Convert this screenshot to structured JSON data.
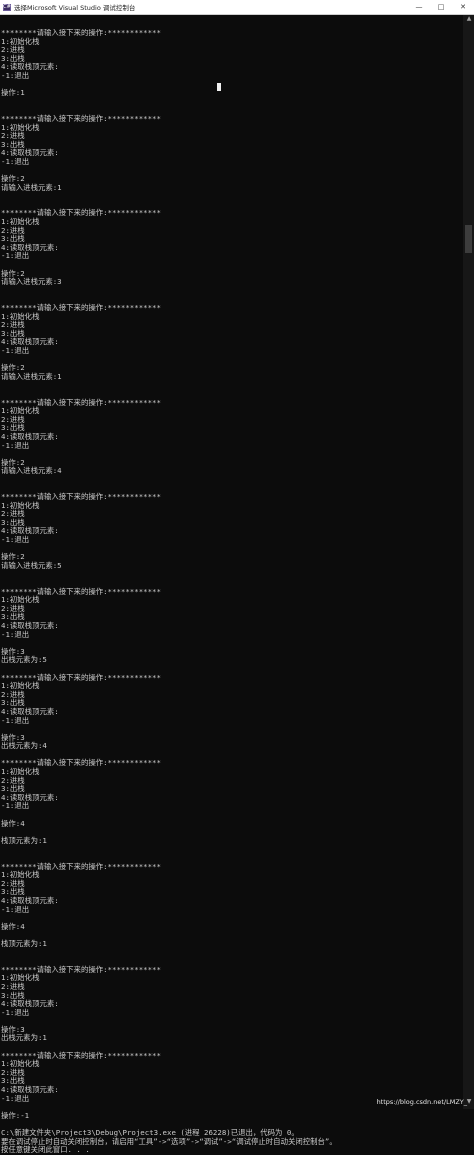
{
  "window": {
    "title": "选择Microsoft Visual Studio 调试控制台",
    "app_icon_glyph": "C#",
    "controls": [
      "—",
      "□",
      "✕"
    ]
  },
  "console_lines": [
    "********请输入接下来的操作:************",
    "1:初始化栈",
    "2:进栈",
    "3:出栈",
    "4:读取栈顶元素:",
    "-1:退出",
    "",
    "操作:1",
    "",
    "",
    "********请输入接下来的操作:************",
    "1:初始化栈",
    "2:进栈",
    "3:出栈",
    "4:读取栈顶元素:",
    "-1:退出",
    "",
    "操作:2",
    "请输入进栈元素:1",
    "",
    "",
    "********请输入接下来的操作:************",
    "1:初始化栈",
    "2:进栈",
    "3:出栈",
    "4:读取栈顶元素:",
    "-1:退出",
    "",
    "操作:2",
    "请输入进栈元素:3",
    "",
    "",
    "********请输入接下来的操作:************",
    "1:初始化栈",
    "2:进栈",
    "3:出栈",
    "4:读取栈顶元素:",
    "-1:退出",
    "",
    "操作:2",
    "请输入进栈元素:1",
    "",
    "",
    "********请输入接下来的操作:************",
    "1:初始化栈",
    "2:进栈",
    "3:出栈",
    "4:读取栈顶元素:",
    "-1:退出",
    "",
    "操作:2",
    "请输入进栈元素:4",
    "",
    "",
    "********请输入接下来的操作:************",
    "1:初始化栈",
    "2:进栈",
    "3:出栈",
    "4:读取栈顶元素:",
    "-1:退出",
    "",
    "操作:2",
    "请输入进栈元素:5",
    "",
    "",
    "********请输入接下来的操作:************",
    "1:初始化栈",
    "2:进栈",
    "3:出栈",
    "4:读取栈顶元素:",
    "-1:退出",
    "",
    "操作:3",
    "出栈元素为:5",
    "",
    "********请输入接下来的操作:************",
    "1:初始化栈",
    "2:进栈",
    "3:出栈",
    "4:读取栈顶元素:",
    "-1:退出",
    "",
    "操作:3",
    "出栈元素为:4",
    "",
    "********请输入接下来的操作:************",
    "1:初始化栈",
    "2:进栈",
    "3:出栈",
    "4:读取栈顶元素:",
    "-1:退出",
    "",
    "操作:4",
    "",
    "栈顶元素为:1",
    "",
    "",
    "********请输入接下来的操作:************",
    "1:初始化栈",
    "2:进栈",
    "3:出栈",
    "4:读取栈顶元素:",
    "-1:退出",
    "",
    "操作:4",
    "",
    "栈顶元素为:1",
    "",
    "",
    "********请输入接下来的操作:************",
    "1:初始化栈",
    "2:进栈",
    "3:出栈",
    "4:读取栈顶元素:",
    "-1:退出",
    "",
    "操作:3",
    "出栈元素为:1",
    "",
    "********请输入接下来的操作:************",
    "1:初始化栈",
    "2:进栈",
    "3:出栈",
    "4:读取栈顶元素:",
    "-1:退出",
    "",
    "操作:-1",
    "",
    "C:\\新建文件夹\\Project3\\Debug\\Project3.exe (进程 26228)已退出，代码为 0。",
    "要在调试停止时自动关闭控制台，请启用“工具”->“选项”->“调试”->“调试停止时自动关闭控制台”。",
    "按任意键关闭此窗口. . ."
  ],
  "scrollbar": {
    "up_glyph": "▲",
    "down_glyph": "▼"
  },
  "watermark": "https://blog.csdn.net/LMZY_"
}
